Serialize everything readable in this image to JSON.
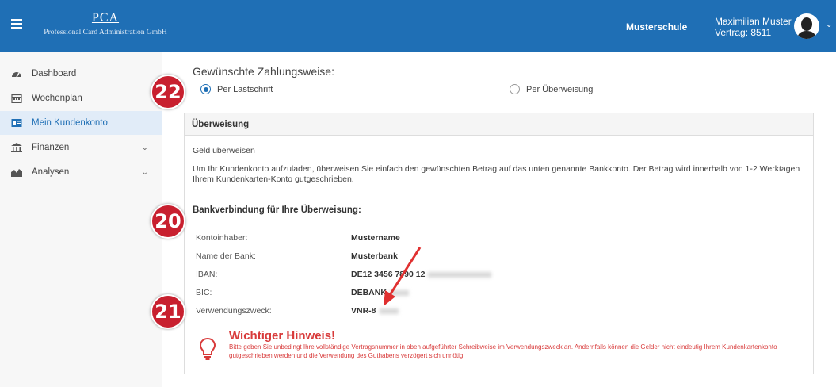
{
  "header": {
    "logo_mark": "PCA",
    "logo_sub": "Professional Card Administration GmbH",
    "school": "Musterschule",
    "user_name": "Maximilian Muster",
    "contract": "Vertrag: 8511"
  },
  "sidebar": {
    "items": [
      {
        "label": "Dashboard",
        "icon": "dashboard-icon"
      },
      {
        "label": "Wochenplan",
        "icon": "calendar-icon"
      },
      {
        "label": "Mein Kundenkonto",
        "icon": "id-card-icon",
        "active": true
      },
      {
        "label": "Finanzen",
        "icon": "bank-icon",
        "expandable": true
      },
      {
        "label": "Analysen",
        "icon": "chart-icon",
        "expandable": true
      }
    ]
  },
  "payment": {
    "title": "Gewünschte Zahlungsweise:",
    "option_lastschrift": "Per Lastschrift",
    "option_ueberweisung": "Per Überweisung",
    "selected": "Per Lastschrift"
  },
  "panel": {
    "heading": "Überweisung",
    "subheading": "Geld überweisen",
    "description": "Um Ihr Kundenkonto aufzuladen, überweisen Sie einfach den gewünschten Betrag auf das unten genannte Bankkonto. Der Betrag wird innerhalb von 1-2 Werktagen Ihrem Kundenkarten-Konto gutgeschrieben.",
    "bank_heading": "Bankverbindung für Ihre Überweisung:",
    "fields": [
      {
        "label": "Kontoinhaber:",
        "value": "Mustername"
      },
      {
        "label": "Name der Bank:",
        "value": "Musterbank"
      },
      {
        "label": "IBAN:",
        "value": "DE12 3456 7890 12"
      },
      {
        "label": "BIC:",
        "value": "DEBANK"
      },
      {
        "label": "Verwendungszweck:",
        "value": "VNR-8"
      }
    ]
  },
  "warning": {
    "title": "Wichtiger Hinweis!",
    "text": "Bitte geben Sie unbedingt Ihre vollständige Vertragsnummer in oben aufgeführter Schreibweise im Verwendungszweck an. Andernfalls können die Gelder nicht eindeutig Ihrem Kundenkartenkonto gutgeschrieben werden und die Verwendung des Guthabens verzögert sich unnötig."
  },
  "callouts": [
    "22",
    "20",
    "21"
  ],
  "colors": {
    "primary": "#1f6fb5",
    "warning": "#d83a3a",
    "badge": "#c8202f"
  }
}
